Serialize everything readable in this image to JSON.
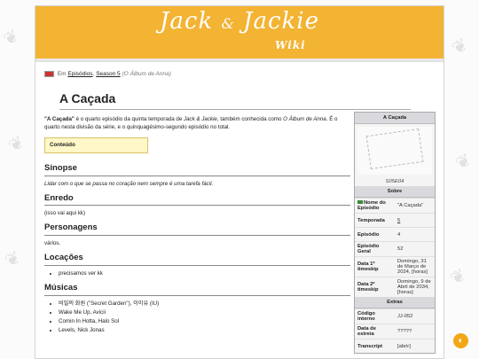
{
  "logo": {
    "left": "Jack",
    "amp": "&",
    "right": "Jackie",
    "wiki": "Wiki"
  },
  "breadcrumb": {
    "prefix": "Em",
    "link1": "Episódios",
    "sep": ",",
    "link2": "Season 5",
    "note": "(O Álbum de Anna)"
  },
  "page_title": "A Caçada",
  "intro": {
    "bold": "\"A Caçada\"",
    "text1": " é o quarto episódio da quinta temporada de ",
    "show": "Jack & Jackie",
    "text2": ", também conhecida como ",
    "alt": "O Álbum de Anna",
    "text3": ". É o quarto nesta divisão da série, e o quinquagésimo-segundo episódio no total."
  },
  "toc_label": "Conteúdo",
  "sections": {
    "sinopse": {
      "title": "Sinopse",
      "body": "Lidar com o que se passa no coração nem sempre é uma tarefa fácil."
    },
    "enredo": {
      "title": "Enredo",
      "body": "(isso vai aqui kk)"
    },
    "personagens": {
      "title": "Personagens",
      "body": "vários."
    },
    "locacoes": {
      "title": "Locações",
      "items": [
        "precisamos ver kk"
      ]
    },
    "musicas": {
      "title": "Músicas",
      "items": [
        "비밀의 화원 (\"Secret Garden\"), 이이유 (IU)",
        "Wake Me Up, Avicii",
        "Comin In Hotta, Halo Sol",
        "Levels, Nick Jonas"
      ]
    }
  },
  "infobox": {
    "header": "A Caçada",
    "caption": "S05E04",
    "sobre": "Sobre",
    "rows": [
      {
        "k": "Nome do Episódio",
        "v": "\"A Caçada\""
      },
      {
        "k": "Temporada",
        "v": "5"
      },
      {
        "k": "Episódio",
        "v": "4"
      },
      {
        "k": "Episódio Geral",
        "v": "52"
      },
      {
        "k": "Data 1º timeskip",
        "v": "Domingo, 31 de Março de 2024, [horas]"
      },
      {
        "k": "Data 2º timeskip",
        "v": "Domingo, 9 de Abril de 2034, [horas]"
      }
    ],
    "extras": "Extras",
    "rows2": [
      {
        "k": "Código interno",
        "v": "JJ-052"
      },
      {
        "k": "Data de estreia",
        "v": "?????"
      },
      {
        "k": "Transcript",
        "v": "[abrir]"
      }
    ]
  },
  "fab_icon": "theme-toggle-icon"
}
